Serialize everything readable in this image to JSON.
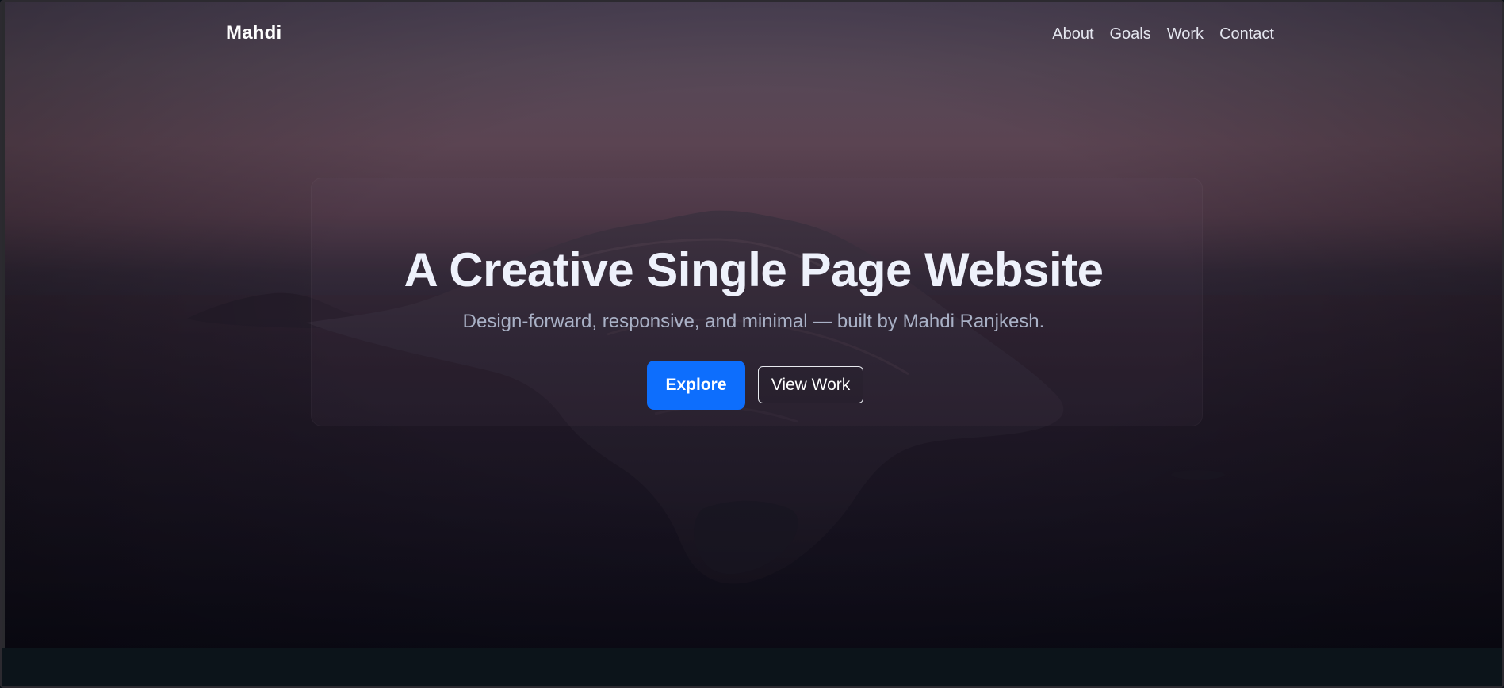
{
  "header": {
    "logo": "Mahdi",
    "nav": [
      {
        "label": "About"
      },
      {
        "label": "Goals"
      },
      {
        "label": "Work"
      },
      {
        "label": "Contact"
      }
    ]
  },
  "hero": {
    "headline": "A Creative Single Page Website",
    "subheadline": "Design-forward, responsive, and minimal — built by Mahdi Ranjkesh.",
    "primary_button": "Explore",
    "secondary_button": "View Work"
  },
  "colors": {
    "accent": "#0d6efd",
    "headline": "#eef1fb",
    "subheadline": "#a9b1c6",
    "background_top": "#4d4357",
    "background_bottom": "#0f0e1b"
  }
}
